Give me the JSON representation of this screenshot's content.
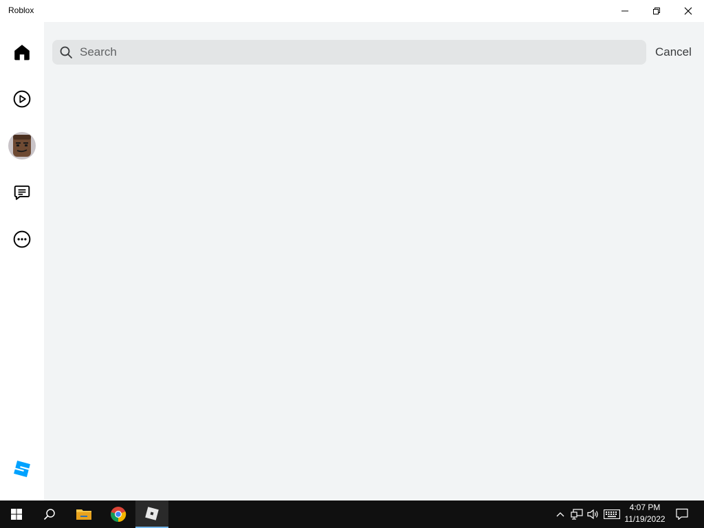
{
  "window": {
    "title": "Roblox"
  },
  "sidebar": {
    "items": [
      {
        "icon": "home-icon"
      },
      {
        "icon": "play-icon"
      },
      {
        "icon": "avatar"
      },
      {
        "icon": "chat-icon"
      },
      {
        "icon": "more-icon"
      },
      {
        "icon": "roblox-studio-icon"
      }
    ]
  },
  "search": {
    "placeholder": "Search",
    "value": "",
    "cancel_label": "Cancel"
  },
  "taskbar": {
    "time": "4:07 PM",
    "date": "11/19/2022",
    "pinned": [
      "windows-start-icon",
      "search-icon",
      "file-explorer-icon",
      "chrome-icon",
      "roblox-icon"
    ]
  },
  "colors": {
    "main_bg": "#f2f4f5",
    "search_bg": "#e3e5e6",
    "taskbar_bg": "#101010",
    "active_indicator": "#76b9ed"
  }
}
